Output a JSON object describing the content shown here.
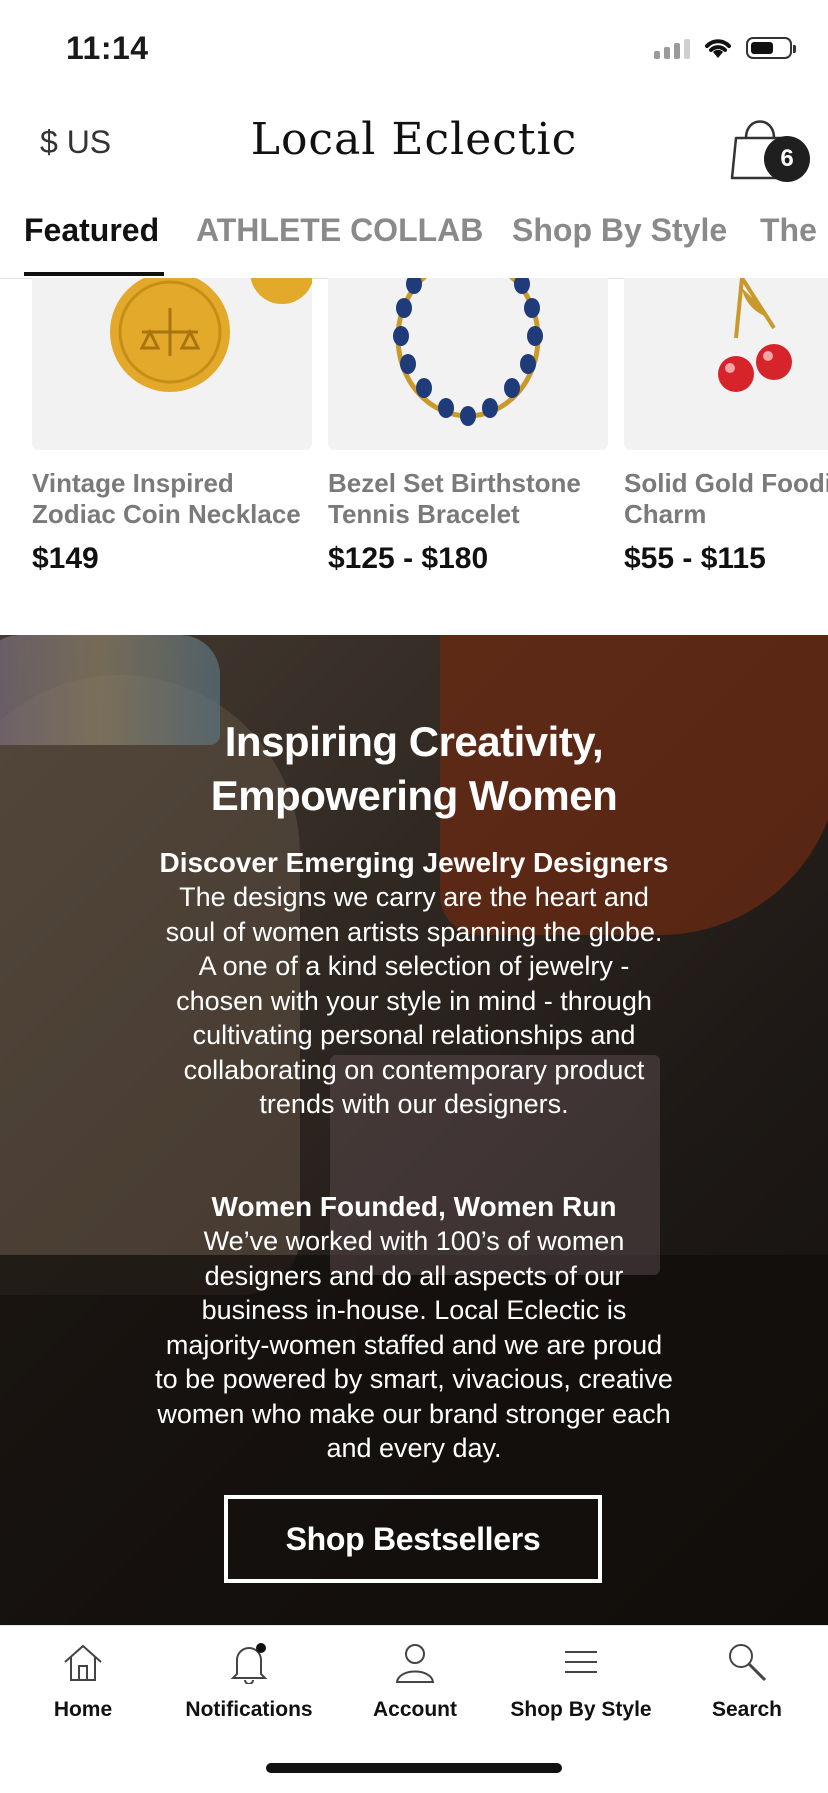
{
  "status": {
    "time": "11:14"
  },
  "header": {
    "currency": "$ US",
    "logo": "Local Eclectic",
    "cart_count": "6"
  },
  "tabs": [
    {
      "label": "Featured",
      "active": true
    },
    {
      "label": "ATHLETE COLLAB",
      "active": false
    },
    {
      "label": "Shop By Style",
      "active": false
    },
    {
      "label": "The",
      "active": false
    }
  ],
  "products": [
    {
      "name_line1": "Vintage Inspired",
      "name_line2": "Zodiac Coin Necklace",
      "price": "$149"
    },
    {
      "name_line1": "Bezel Set Birthstone",
      "name_line2": "Tennis Bracelet",
      "price": "$125 - $180"
    },
    {
      "name_line1": "Solid Gold Foodi",
      "name_line2": "Charm",
      "price": "$55 - $115"
    }
  ],
  "hero": {
    "title_line1": "Inspiring Creativity,",
    "title_line2": "Empowering Women",
    "section1_heading": "Discover Emerging Jewelry Designers",
    "section1_body": [
      "The designs we carry are the heart and",
      "soul of women artists spanning the globe.",
      "A one of a kind selection of jewelry -",
      "chosen with your style in mind - through",
      "cultivating personal relationships and",
      "collaborating on contemporary product",
      "trends with our designers."
    ],
    "section2_heading": "Women Founded, Women Run",
    "section2_body": [
      "We’ve worked with 100’s of women",
      "designers and do all aspects of our",
      "business in-house. Local Eclectic is",
      "majority-women staffed and we are proud",
      "to be powered by smart, vivacious, creative",
      "women who make our brand stronger each",
      "and every day."
    ],
    "button": "Shop Bestsellers"
  },
  "tabbar": [
    {
      "label": "Home",
      "icon": "home-icon"
    },
    {
      "label": "Notifications",
      "icon": "bell-icon"
    },
    {
      "label": "Account",
      "icon": "account-icon"
    },
    {
      "label": "Shop By Style",
      "icon": "menu-lines-icon"
    },
    {
      "label": "Search",
      "icon": "search-icon"
    }
  ]
}
